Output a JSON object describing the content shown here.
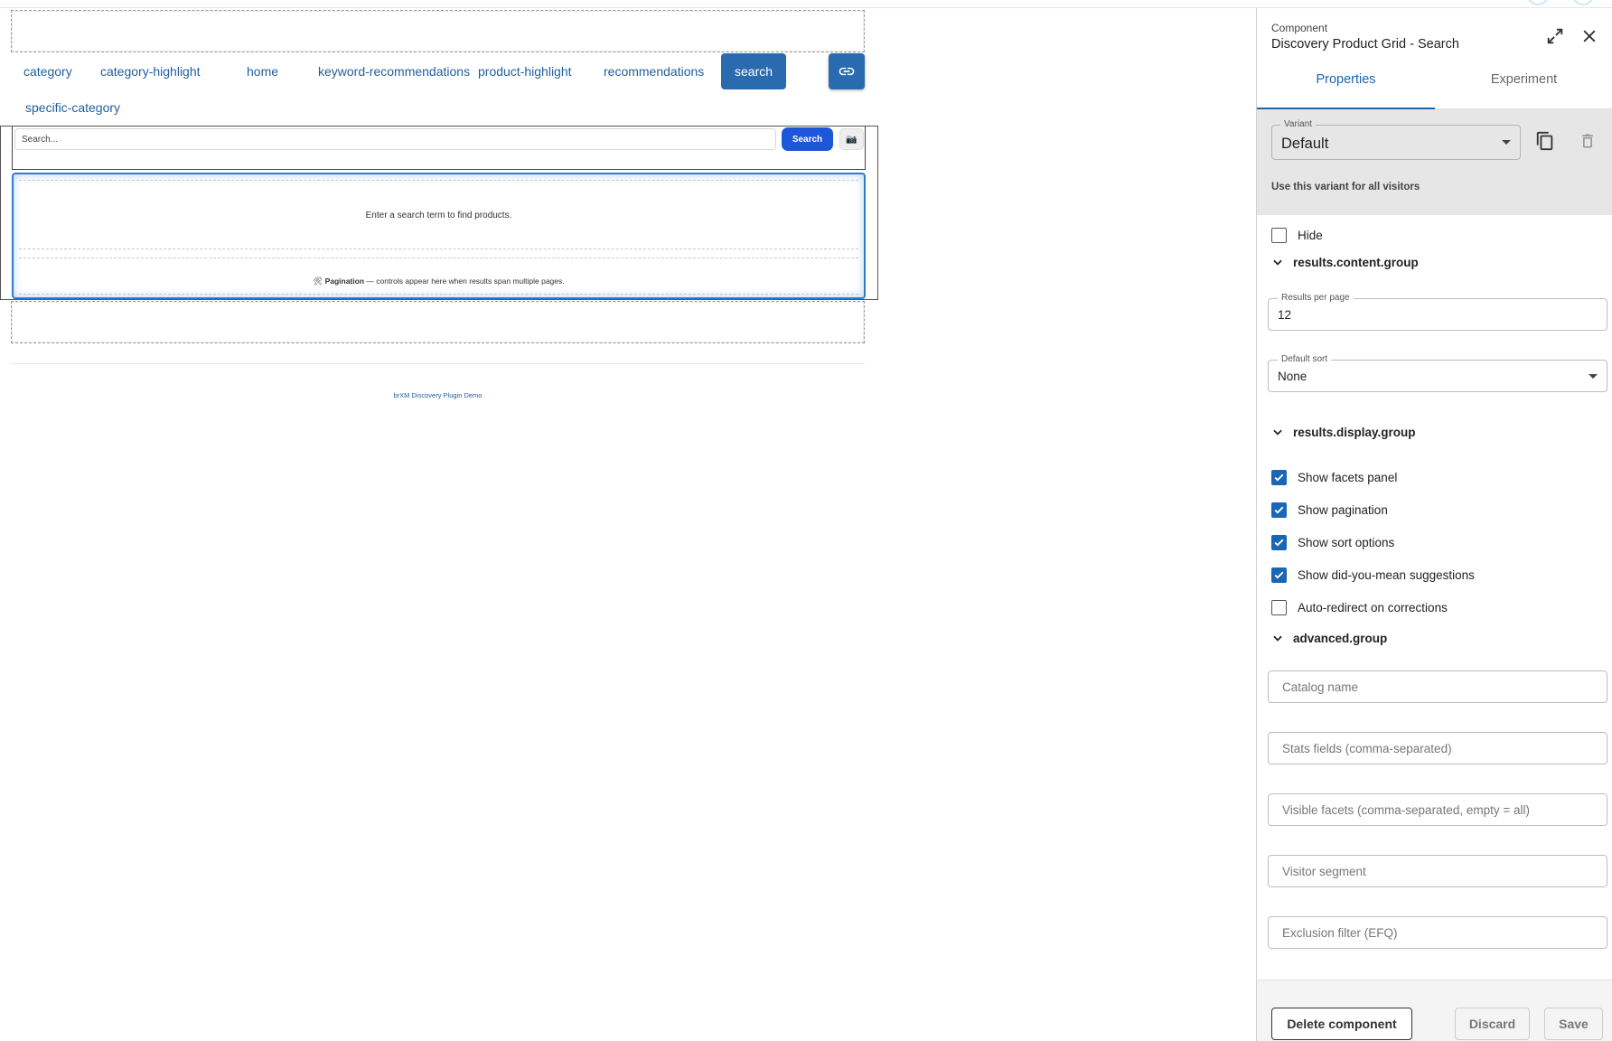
{
  "preview": {
    "nav": [
      {
        "label": "category",
        "active": false
      },
      {
        "label": "category-highlight",
        "active": false
      },
      {
        "label": "home",
        "active": false
      },
      {
        "label": "keyword-recommendations",
        "active": false
      },
      {
        "label": "product-highlight",
        "active": false
      },
      {
        "label": "recommendations",
        "active": false
      },
      {
        "label": "search",
        "active": true
      },
      {
        "label": "specific-category",
        "active": false
      }
    ],
    "search": {
      "placeholder": "Search...",
      "button_label": "Search",
      "camera_glyph": "📷"
    },
    "results": {
      "empty_message": "Enter a search term to find products.",
      "pagination_icon": "🛠",
      "pagination_title": "Pagination",
      "pagination_text": " — controls appear here when results span multiple pages."
    },
    "footer_text": "brXM Discovery Plugin Demo",
    "accent_color": "#2a6bb0"
  },
  "panel": {
    "kicker": "Component",
    "title": "Discovery Product Grid - Search",
    "tabs": [
      {
        "label": "Properties",
        "active": true
      },
      {
        "label": "Experiment",
        "active": false
      }
    ],
    "variant": {
      "label": "Variant",
      "value": "Default",
      "hint": "Use this variant for all visitors"
    },
    "hide": {
      "label": "Hide",
      "checked": false
    },
    "groups": {
      "content": "results.content.group",
      "display": "results.display.group",
      "advanced": "advanced.group"
    },
    "results_per_page": {
      "label": "Results per page",
      "value": "12"
    },
    "default_sort": {
      "label": "Default sort",
      "value": "None"
    },
    "display_options": [
      {
        "label": "Show facets panel",
        "checked": true
      },
      {
        "label": "Show pagination",
        "checked": true
      },
      {
        "label": "Show sort options",
        "checked": true
      },
      {
        "label": "Show did-you-mean suggestions",
        "checked": true
      },
      {
        "label": "Auto-redirect on corrections",
        "checked": false
      }
    ],
    "advanced_fields": [
      {
        "placeholder": "Catalog name"
      },
      {
        "placeholder": "Stats fields (comma-separated)"
      },
      {
        "placeholder": "Visible facets (comma-separated, empty = all)"
      },
      {
        "placeholder": "Visitor segment"
      },
      {
        "placeholder": "Exclusion filter (EFQ)"
      }
    ],
    "footer": {
      "delete_label": "Delete component",
      "discard_label": "Discard",
      "save_label": "Save"
    },
    "primary_color": "#1966b5",
    "icons": [
      "expand-icon",
      "close-icon",
      "copy-icon",
      "trash-icon",
      "chevron-down-icon",
      "check-icon"
    ]
  }
}
